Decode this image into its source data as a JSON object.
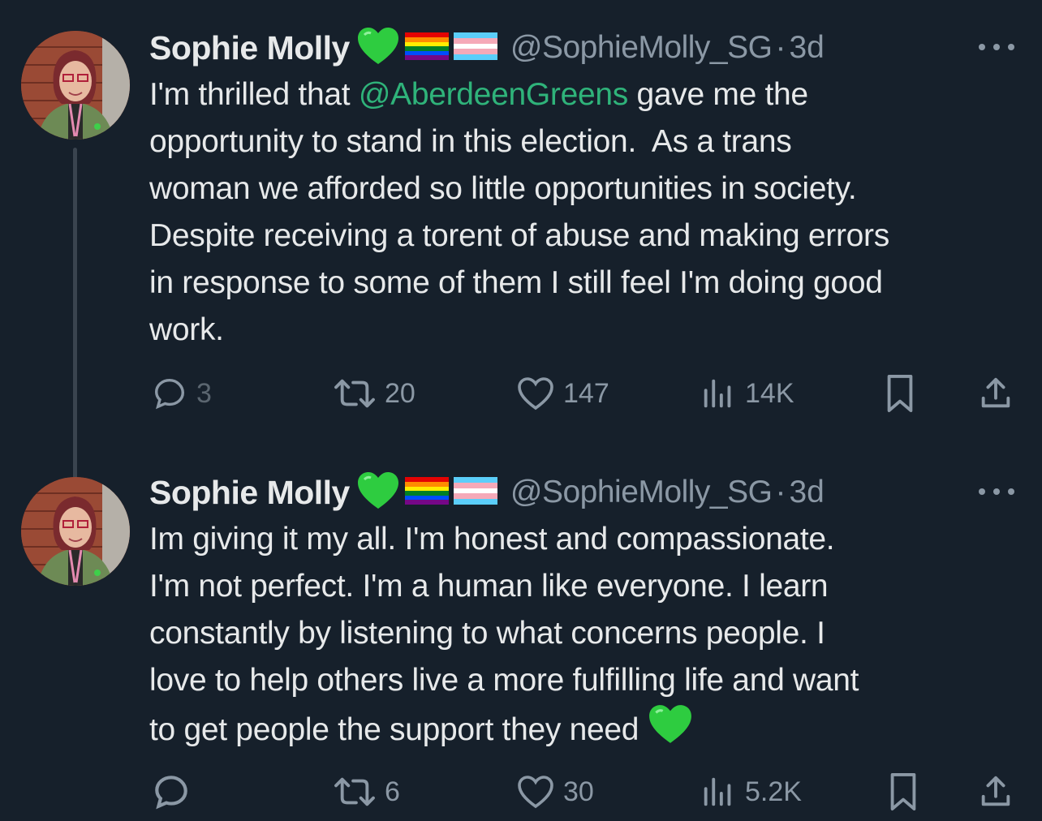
{
  "colors": {
    "background": "#16202b",
    "text": "#e7e9ea",
    "muted": "#8b98a5",
    "mention": "#2fb37a",
    "green_heart": "#2ecc40"
  },
  "tweets": [
    {
      "author_name": "Sophie Molly",
      "handle": "@SophieMolly_SG",
      "separator": "·",
      "time": "3d",
      "badges": [
        "green-heart-icon",
        "rainbow-flag-icon",
        "transgender-flag-icon"
      ],
      "text_before_mention": "I'm thrilled that ",
      "mention": "@AberdeenGreens",
      "text_after_mention": " gave me the\nopportunity to stand in this election.  As a trans\nwoman we afforded so little opportunities in society.\nDespite receiving a torent of abuse and making errors\nin response to some of them I still feel I'm doing good\nwork.",
      "replies": "3",
      "retweets": "20",
      "likes": "147",
      "views": "14K"
    },
    {
      "author_name": "Sophie Molly",
      "handle": "@SophieMolly_SG",
      "separator": "·",
      "time": "3d",
      "badges": [
        "green-heart-icon",
        "rainbow-flag-icon",
        "transgender-flag-icon"
      ],
      "text": "Im giving it my all. I'm honest and compassionate.\nI'm not perfect. I'm a human like everyone. I learn\nconstantly by listening to what concerns people. I\nlove to help others live a more fulfilling life and want\nto get people the support they need ",
      "replies": "",
      "retweets": "6",
      "likes": "30",
      "views": "5.2K"
    }
  ]
}
